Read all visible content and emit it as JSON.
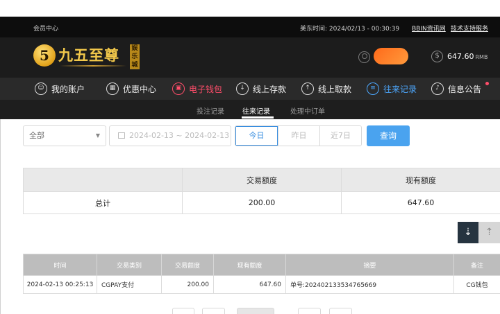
{
  "topbar": {
    "member_center": "会员中心",
    "us_east_time": "美东时间: 2024/02/13 - 00:30:39",
    "link_bbin": "BBIN资讯网",
    "link_support": "技术支持服务"
  },
  "header": {
    "logo_mark": "5",
    "logo_title": "九五至尊",
    "logo_sub": "娱乐城",
    "balance": "647.60",
    "currency": "RMB"
  },
  "nav": {
    "items": [
      {
        "label": "我的账户",
        "icon": "person-icon"
      },
      {
        "label": "优惠中心",
        "icon": "gift-icon"
      },
      {
        "label": "电子钱包",
        "icon": "wallet-icon"
      },
      {
        "label": "线上存款",
        "icon": "deposit-icon"
      },
      {
        "label": "线上取款",
        "icon": "withdraw-icon"
      },
      {
        "label": "往来记录",
        "icon": "records-icon"
      },
      {
        "label": "信息公告",
        "icon": "bell-icon"
      }
    ]
  },
  "subnav": {
    "tabs": [
      "投注记录",
      "往来记录",
      "处理中订单"
    ],
    "active": "往来记录"
  },
  "filters": {
    "type_value": "全部",
    "date_range": "2024-02-13 ~ 2024-02-13",
    "quick": [
      "今日",
      "昨日",
      "近7日"
    ],
    "query_label": "查询"
  },
  "summary": {
    "headers": [
      "",
      "交易额度",
      "现有额度"
    ],
    "row": {
      "label": "总计",
      "amount": "200.00",
      "current": "647.60"
    }
  },
  "records": {
    "headers": [
      "时间",
      "交易类别",
      "交易额度",
      "现有额度",
      "摘要",
      "备注"
    ],
    "rows": [
      {
        "time": "2024-02-13 00:25:13",
        "type": "CGPAY支付",
        "amount": "200.00",
        "current": "647.60",
        "summary": "单号:202402133534765669",
        "note": "CG钱包"
      }
    ]
  },
  "colors": {
    "accent_blue": "#4aa3ef",
    "active_nav": "#4da8ff",
    "wallet_red": "#ff4d6a",
    "gold": "#f2c84b"
  }
}
